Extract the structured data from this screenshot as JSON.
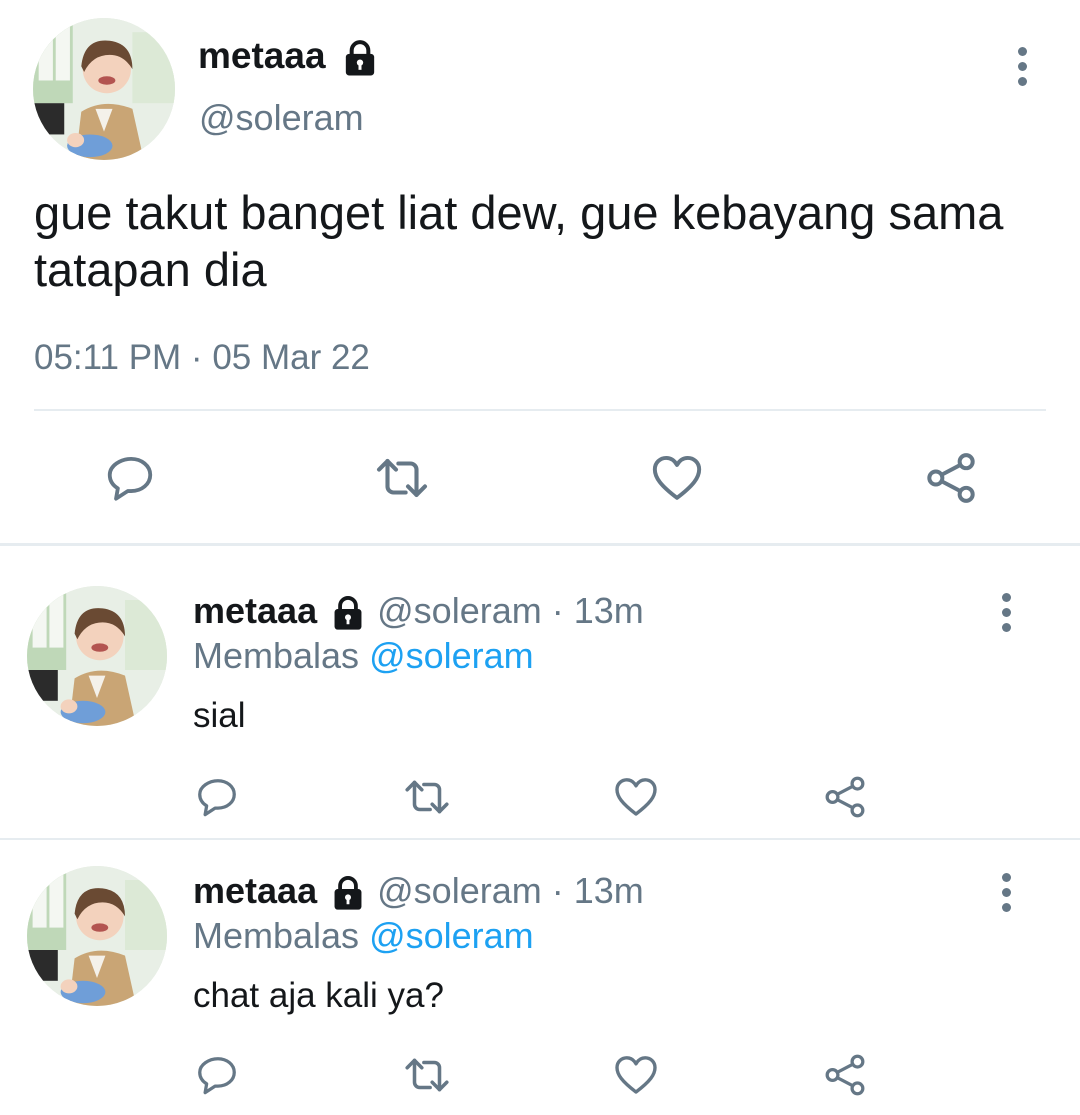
{
  "main_tweet": {
    "name": "metaaa",
    "handle": "@soleram",
    "text": "gue takut banget liat dew, gue kebayang sama tatapan dia",
    "timestamp": "05:11 PM · 05 Mar 22",
    "icons": {
      "lock": "lock-icon",
      "menu": "more-vertical-icon",
      "reply": "reply-icon",
      "retweet": "retweet-icon",
      "like": "heart-icon",
      "share": "share-icon"
    }
  },
  "replies": [
    {
      "name": "metaaa",
      "handle": "@soleram",
      "separator": " · ",
      "time": "13m",
      "replying_prefix": "Membalas ",
      "replying_to": "@soleram",
      "text": "sial"
    },
    {
      "name": "metaaa",
      "handle": "@soleram",
      "separator": " · ",
      "time": "13m",
      "replying_prefix": "Membalas ",
      "replying_to": "@soleram",
      "text": "chat aja kali ya?"
    }
  ],
  "colors": {
    "text": "#14171a",
    "secondary": "#657786",
    "link": "#1da1f2",
    "divider": "#e6ecf0"
  }
}
